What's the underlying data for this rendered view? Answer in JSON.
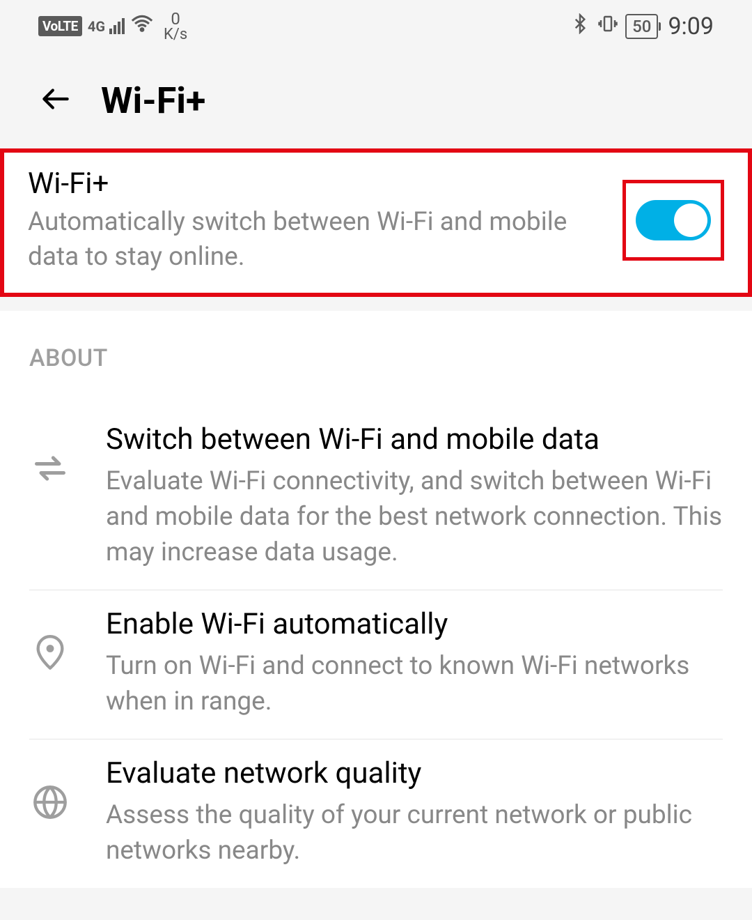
{
  "status_bar": {
    "volte": "VoLTE",
    "network_type": "4G",
    "data_rate_value": "0",
    "data_rate_unit": "K/s",
    "battery_level": "50",
    "clock": "9:09"
  },
  "header": {
    "title": "Wi-Fi+"
  },
  "main_toggle": {
    "title": "Wi-Fi+",
    "description": "Automatically switch between Wi-Fi and mobile data to stay online.",
    "enabled": true
  },
  "about": {
    "heading": "ABOUT",
    "items": [
      {
        "icon": "swap-arrows-icon",
        "title": "Switch between Wi-Fi and mobile data",
        "description": "Evaluate Wi-Fi connectivity, and switch between Wi-Fi and mobile data for the best network connection. This may increase data usage."
      },
      {
        "icon": "location-pin-icon",
        "title": "Enable Wi-Fi automatically",
        "description": "Turn on Wi-Fi and connect to known Wi-Fi networks when in range."
      },
      {
        "icon": "globe-icon",
        "title": "Evaluate network quality",
        "description": "Assess the quality of your current network or public networks nearby."
      }
    ]
  }
}
